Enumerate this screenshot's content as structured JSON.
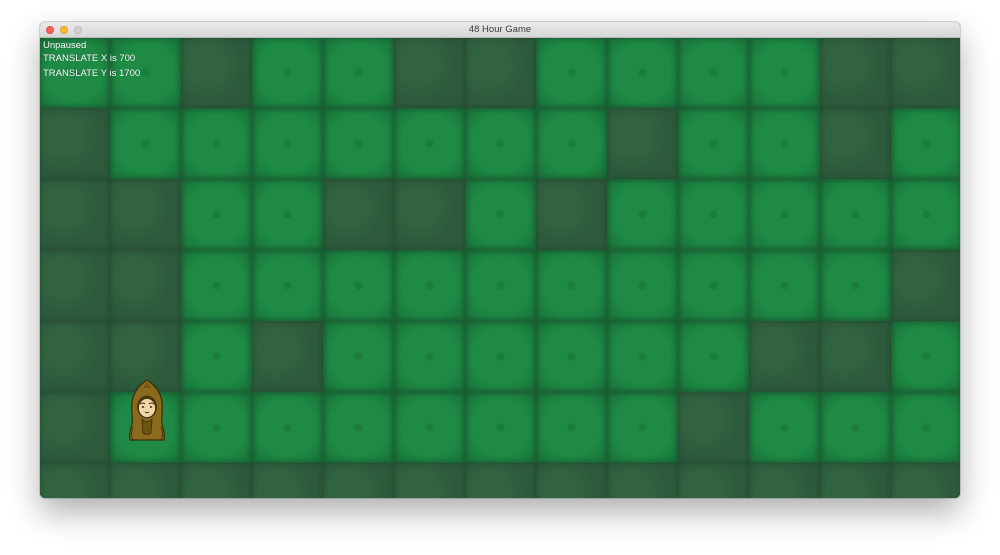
{
  "window": {
    "title": "48 Hour Game"
  },
  "hud": {
    "status": "Unpaused",
    "translate_x": "TRANSLATE X is 700",
    "translate_y": "TRANSLATE Y is 1700"
  },
  "map": {
    "cols": 13,
    "rows": 7,
    "tiles": [
      "GGDGGDDGGGGDD",
      "DGGGGGGGDGGDG",
      "DDGGDDGDGGGGG",
      "DDGGGGGGGGGGD",
      "DDGDGGGGGGDDG",
      "DPGGGGGGGDGGG",
      "DDDDDDDDDDDDD"
    ],
    "legend": {
      "G": "grass",
      "D": "dirt",
      "P": "player-on-grass"
    }
  },
  "player": {
    "icon": "hooded-character-icon",
    "column": 2,
    "row": 6
  },
  "colors": {
    "grass": "#1e8a45",
    "dark_grass": "#2c5a3b",
    "hud_text": "#ffffff",
    "cloak": "#8a6a1c"
  }
}
